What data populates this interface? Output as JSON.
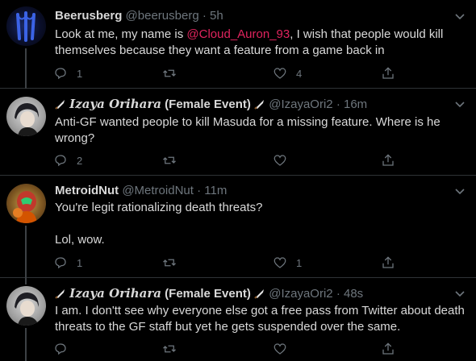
{
  "tweets": [
    {
      "display_name": "Beerusberg",
      "handle": "@beerusberg",
      "separator": "·",
      "time": "5h",
      "text_before": "Look at me, my name is ",
      "mention": "@Cloud_Auron_93",
      "text_after": ", I wish that people would kill\nthemselves because they want a feature from a game back in",
      "replies": "1",
      "retweets": "",
      "likes": "4"
    },
    {
      "display_name_fancy": "Izaya Orihara",
      "display_name_suffix": "(Female Event)",
      "handle": "@IzayaOri2",
      "separator": "·",
      "time": "16m",
      "text": "Anti-GF wanted people to kill Masuda for a missing feature. Where is he\nwrong?",
      "replies": "2",
      "retweets": "",
      "likes": ""
    },
    {
      "display_name": "MetroidNut",
      "handle": "@MetroidNut",
      "separator": "·",
      "time": "11m",
      "text": "You're legit rationalizing death threats?\n\nLol, wow.",
      "replies": "1",
      "retweets": "",
      "likes": "1"
    },
    {
      "display_name_fancy": "Izaya Orihara",
      "display_name_suffix": "(Female Event)",
      "handle": "@IzayaOri2",
      "separator": "·",
      "time": "48s",
      "text": "I am. I don'tt see why everyone else got a free pass from Twitter about death\nthreats to the GF staff but yet he gets suspended over the same.",
      "replies": "",
      "retweets": "",
      "likes": ""
    }
  ],
  "icons": {
    "reply": "reply-icon",
    "retweet": "retweet-icon",
    "like": "heart-icon",
    "share": "share-icon",
    "more": "chevron-down-icon",
    "emoji": "knife-emoji"
  },
  "colors": {
    "background": "#000000",
    "text": "#d9d9d9",
    "muted": "#6e767d",
    "mention": "#e0245e"
  }
}
